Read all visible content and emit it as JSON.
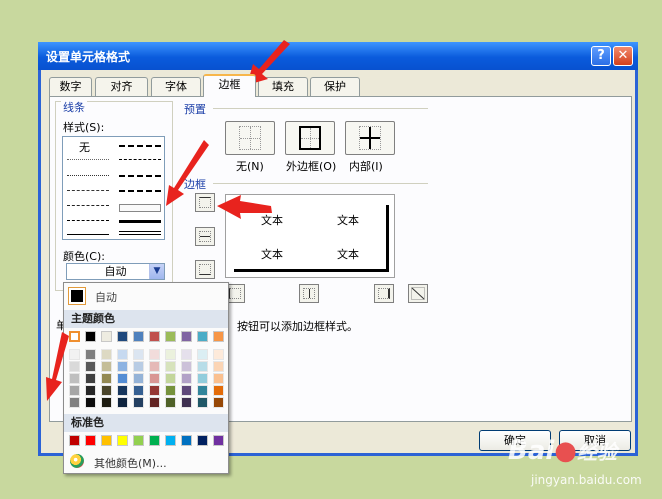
{
  "window": {
    "title": "设置单元格格式",
    "help": "?",
    "close": "✕"
  },
  "tabs": [
    {
      "label": "数字",
      "active": false
    },
    {
      "label": "对齐",
      "active": false
    },
    {
      "label": "字体",
      "active": false
    },
    {
      "label": "边框",
      "active": true
    },
    {
      "label": "填充",
      "active": false
    },
    {
      "label": "保护",
      "active": false
    }
  ],
  "line": {
    "group_label": "线条",
    "style_label": "样式(S):",
    "none_label": "无",
    "color_label": "颜色(C):",
    "color_value": "自动"
  },
  "presets": {
    "group_label": "预置",
    "none": "无(N)",
    "outline": "外边框(O)",
    "inside": "内部(I)"
  },
  "border": {
    "group_label": "边框",
    "preview_texts": [
      "文本",
      "文本",
      "文本",
      "文本"
    ]
  },
  "hint": {
    "left_char": "单",
    "text": "按钮可以添加边框样式。"
  },
  "buttons": {
    "ok": "确定",
    "cancel": "取消"
  },
  "palette": {
    "auto_label": "自动",
    "theme_label": "主题颜色",
    "standard_label": "标准色",
    "more_label": "其他颜色(M)...",
    "theme_top": [
      "#ffffff",
      "#000000",
      "#eeece1",
      "#1f497d",
      "#4f81bd",
      "#c0504d",
      "#9bbb59",
      "#8064a2",
      "#4bacc6",
      "#f79646"
    ],
    "theme_shades": [
      [
        "#f2f2f2",
        "#d9d9d9",
        "#bfbfbf",
        "#a6a6a6",
        "#808080"
      ],
      [
        "#7f7f7f",
        "#595959",
        "#404040",
        "#262626",
        "#0d0d0d"
      ],
      [
        "#ddd9c3",
        "#c4bd97",
        "#938953",
        "#4a452a",
        "#1e1c11"
      ],
      [
        "#c6d9f0",
        "#8db3e2",
        "#548dd4",
        "#17365d",
        "#0f243e"
      ],
      [
        "#dbe5f1",
        "#b8cce4",
        "#95b3d7",
        "#366092",
        "#244061"
      ],
      [
        "#f2dcdb",
        "#e5b9b7",
        "#d99694",
        "#953734",
        "#632423"
      ],
      [
        "#ebf1dd",
        "#d7e3bc",
        "#c3d69b",
        "#76923c",
        "#4f6128"
      ],
      [
        "#e5e0ec",
        "#ccc1d9",
        "#b2a2c7",
        "#5f497a",
        "#3f3151"
      ],
      [
        "#dbeef3",
        "#b7dde8",
        "#92cddc",
        "#31859b",
        "#205867"
      ],
      [
        "#fdeada",
        "#fbd5b5",
        "#fac08f",
        "#e36c09",
        "#974806"
      ]
    ],
    "standard": [
      "#c00000",
      "#ff0000",
      "#ffc000",
      "#ffff00",
      "#92d050",
      "#00b050",
      "#00b0f0",
      "#0070c0",
      "#002060",
      "#7030a0"
    ]
  },
  "watermark": {
    "brand": "Bai",
    "brand_tail": "经验",
    "url": "jingyan.baidu.com"
  },
  "colors": {
    "annotation_arrow": "#e8231e",
    "title_bar": "#0a5bdc",
    "group_title": "#1c3fa8"
  }
}
